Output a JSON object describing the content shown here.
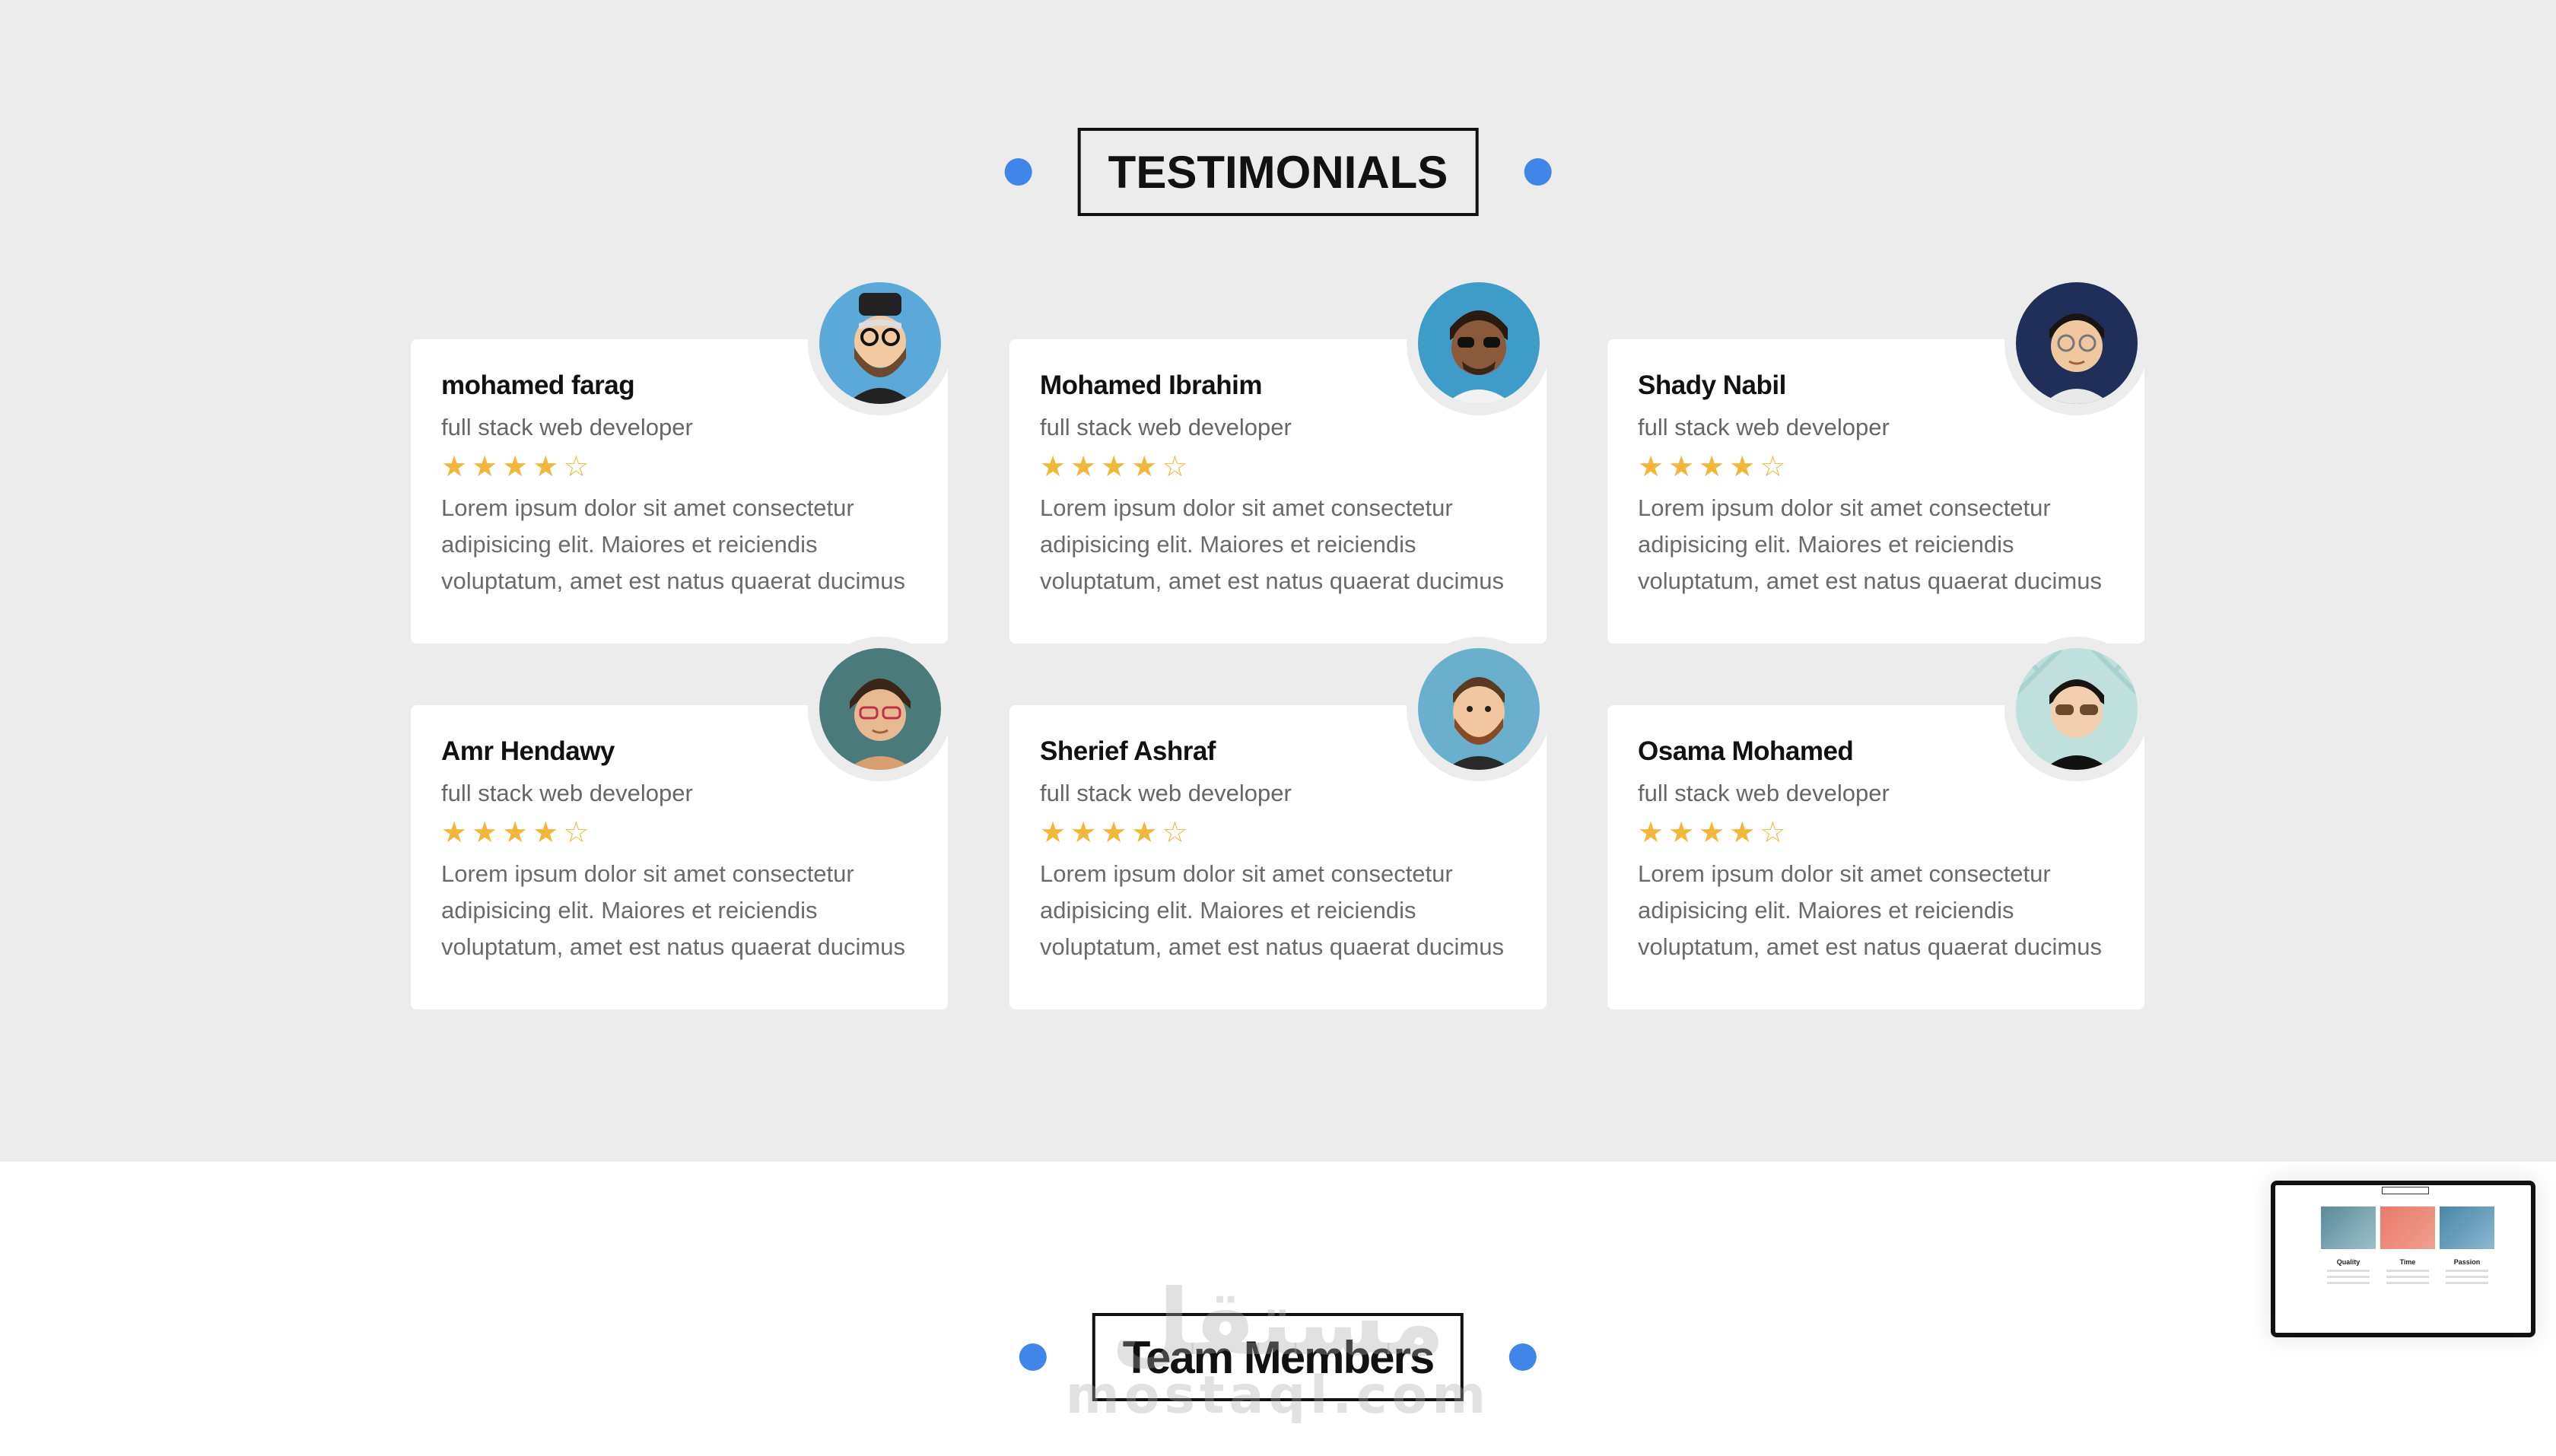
{
  "testimonials": {
    "title": "TESTIMONIALS",
    "cards": [
      {
        "name": "mohamed farag",
        "role": "full stack web developer",
        "rating": 4,
        "max_rating": 5,
        "text": "Lorem ipsum dolor sit amet consectetur adipisicing elit. Maiores et reiciendis voluptatum, amet est natus quaerat ducimus"
      },
      {
        "name": "Mohamed Ibrahim",
        "role": "full stack web developer",
        "rating": 4,
        "max_rating": 5,
        "text": "Lorem ipsum dolor sit amet consectetur adipisicing elit. Maiores et reiciendis voluptatum, amet est natus quaerat ducimus"
      },
      {
        "name": "Shady Nabil",
        "role": "full stack web developer",
        "rating": 4,
        "max_rating": 5,
        "text": "Lorem ipsum dolor sit amet consectetur adipisicing elit. Maiores et reiciendis voluptatum, amet est natus quaerat ducimus"
      },
      {
        "name": "Amr Hendawy",
        "role": "full stack web developer",
        "rating": 4,
        "max_rating": 5,
        "text": "Lorem ipsum dolor sit amet consectetur adipisicing elit. Maiores et reiciendis voluptatum, amet est natus quaerat ducimus"
      },
      {
        "name": "Sherief Ashraf",
        "role": "full stack web developer",
        "rating": 4,
        "max_rating": 5,
        "text": "Lorem ipsum dolor sit amet consectetur adipisicing elit. Maiores et reiciendis voluptatum, amet est natus quaerat ducimus"
      },
      {
        "name": "Osama Mohamed",
        "role": "full stack web developer",
        "rating": 4,
        "max_rating": 5,
        "text": "Lorem ipsum dolor sit amet consectetur adipisicing elit. Maiores et reiciendis voluptatum, amet est natus quaerat ducimus"
      }
    ]
  },
  "team": {
    "title": "Team Members"
  },
  "watermark": {
    "arabic": "مستقل",
    "latin": "mostaql.com"
  },
  "preview": {
    "labels": [
      "Quality",
      "Time",
      "Passion"
    ]
  },
  "colors": {
    "accent_dot": "#3f86e8",
    "star": "#f2b63a",
    "band": "#ececec"
  }
}
